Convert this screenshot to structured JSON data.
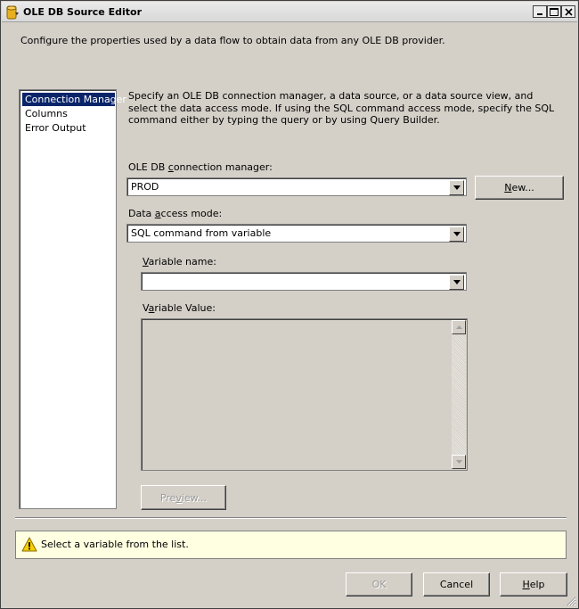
{
  "window": {
    "title": "OLE DB Source Editor",
    "description": "Configure the properties used by a data flow to obtain data from any OLE DB provider."
  },
  "nav": {
    "items": [
      {
        "label": "Connection Manager",
        "selected": true
      },
      {
        "label": "Columns",
        "selected": false
      },
      {
        "label": "Error Output",
        "selected": false
      }
    ]
  },
  "main": {
    "intro": "Specify an OLE DB connection manager, a data source, or a data source view, and select the data access mode. If using the SQL command access mode, specify the SQL command either by typing the query or by using Query Builder.",
    "connection_manager": {
      "label_pre": "OLE DB ",
      "label_u": "c",
      "label_post": "onnection manager:",
      "value": "PROD",
      "new_button_u": "N",
      "new_button_rest": "ew..."
    },
    "access_mode": {
      "label_pre": "Data ",
      "label_u": "a",
      "label_post": "ccess mode:",
      "value": "SQL command from variable"
    },
    "variable_name": {
      "label_u": "V",
      "label_post": "ariable name:",
      "value": ""
    },
    "variable_value": {
      "label_pre": "V",
      "label_u": "a",
      "label_post": "riable Value:",
      "value": ""
    },
    "preview_button": {
      "label_pre": "Pre",
      "label_u": "v",
      "label_post": "iew..."
    }
  },
  "status": {
    "icon": "warning-icon",
    "message": "Select a variable from the list."
  },
  "footer": {
    "ok_label": "OK",
    "cancel_label": "Cancel",
    "help_u": "H",
    "help_rest": "elp"
  },
  "colors": {
    "selection": "#0a246a",
    "status_background": "#ffffe1",
    "dialog_background": "#d4d0c8"
  }
}
